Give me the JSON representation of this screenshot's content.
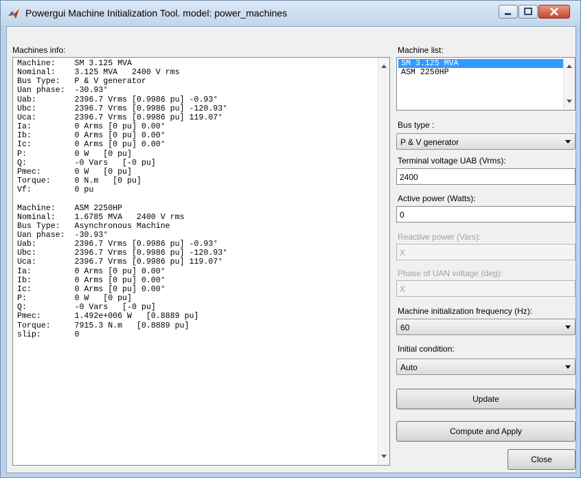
{
  "window": {
    "title": "Powergui Machine Initialization Tool.  model: power_machines"
  },
  "info": {
    "label": "Machines info:",
    "text": "Machine:    SM 3.125 MVA\nNominal:    3.125 MVA   2400 V rms\nBus Type:   P & V generator\nUan phase:  -30.93°\nUab:        2396.7 Vrms [0.9986 pu] -0.93°\nUbc:        2396.7 Vrms [0.9986 pu] -120.93°\nUca:        2396.7 Vrms [0.9986 pu] 119.07°\nIa:         0 Arms [0 pu] 0.00°\nIb:         0 Arms [0 pu] 0.00°\nIc:         0 Arms [0 pu] 0.00°\nP:          0 W   [0 pu]\nQ:          -0 Vars   [-0 pu]\nPmec:       0 W   [0 pu]\nTorque:     0 N.m   [0 pu]\nVf:         0 pu\n\nMachine:    ASM 2250HP\nNominal:    1.6785 MVA   2400 V rms\nBus Type:   Asynchronous Machine\nUan phase:  -30.93°\nUab:        2396.7 Vrms [0.9986 pu] -0.93°\nUbc:        2396.7 Vrms [0.9986 pu] -120.93°\nUca:        2396.7 Vrms [0.9986 pu] 119.07°\nIa:         0 Arms [0 pu] 0.00°\nIb:         0 Arms [0 pu] 0.00°\nIc:         0 Arms [0 pu] 0.00°\nP:          0 W   [0 pu]\nQ:          -0 Vars   [-0 pu]\nPmec:       1.492e+006 W   [0.8889 pu]\nTorque:     7915.3 N.m   [0.8889 pu]\nslip:       0"
  },
  "machine_list": {
    "label": "Machine list:",
    "items": [
      "SM 3.125 MVA",
      "ASM 2250HP"
    ],
    "selected": "SM 3.125 MVA"
  },
  "bus_type": {
    "label": "Bus type :",
    "value": "P & V generator"
  },
  "terminal_voltage": {
    "label": "Terminal voltage UAB (Vrms):",
    "value": "2400"
  },
  "active_power": {
    "label": "Active power (Watts):",
    "value": "0"
  },
  "reactive_power": {
    "label": "Reactive power (Vars):",
    "value": "X"
  },
  "phase_uan": {
    "label": "Phase of UAN voltage (deg):",
    "value": "X"
  },
  "frequency": {
    "label": "Machine initialization frequency (Hz):",
    "value": "60"
  },
  "initial_condition": {
    "label": "Initial condition:",
    "value": "Auto"
  },
  "buttons": {
    "update": "Update",
    "compute_apply": "Compute and Apply",
    "close": "Close"
  },
  "colors": {
    "selection": "#3399ff",
    "close_button": "#c9452a",
    "disabled_text": "#a0a0a0"
  }
}
